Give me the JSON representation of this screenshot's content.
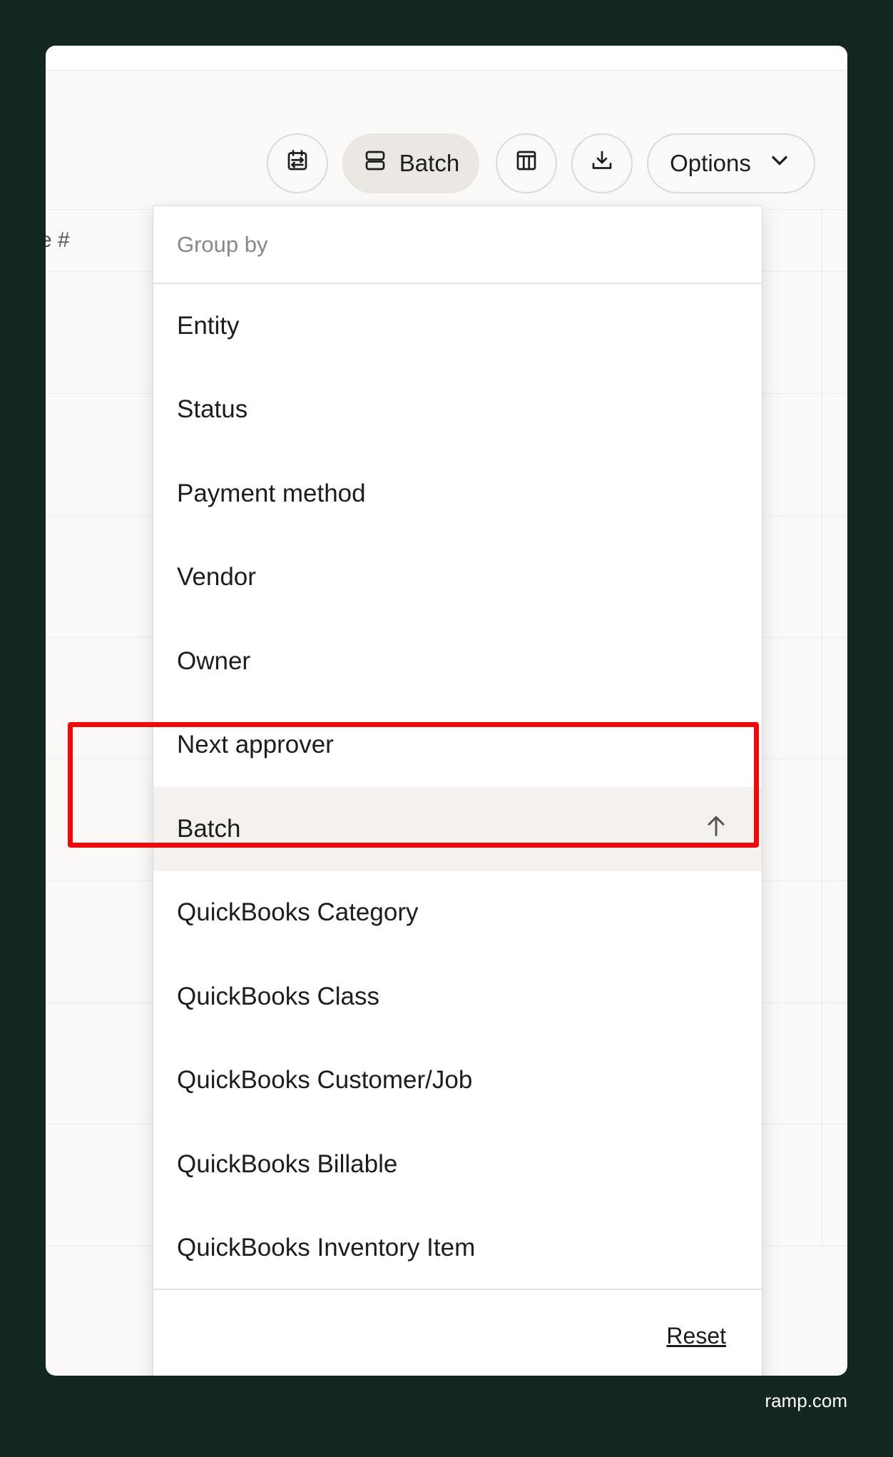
{
  "toolbar": {
    "schedule_icon": "calendar-arrows-icon",
    "batch_label": "Batch",
    "batch_icon": "stack-icon",
    "columns_icon": "table-columns-icon",
    "download_icon": "download-icon",
    "options_label": "Options",
    "options_icon": "chevron-down-icon"
  },
  "table": {
    "header_partial": "e #"
  },
  "menu": {
    "title": "Group by",
    "items": [
      {
        "label": "Entity"
      },
      {
        "label": "Status"
      },
      {
        "label": "Payment method"
      },
      {
        "label": "Vendor"
      },
      {
        "label": "Owner"
      },
      {
        "label": "Next approver"
      },
      {
        "label": "Batch",
        "selected": true,
        "sort_icon": "arrow-up-icon"
      },
      {
        "label": "QuickBooks Category"
      },
      {
        "label": "QuickBooks Class"
      },
      {
        "label": "QuickBooks Customer/Job"
      },
      {
        "label": "QuickBooks Billable"
      },
      {
        "label": "QuickBooks Inventory Item"
      }
    ],
    "reset_label": "Reset"
  },
  "highlight_color": "#ee0a0a",
  "background_color": "#142622",
  "footer": {
    "domain": "ramp.com"
  }
}
